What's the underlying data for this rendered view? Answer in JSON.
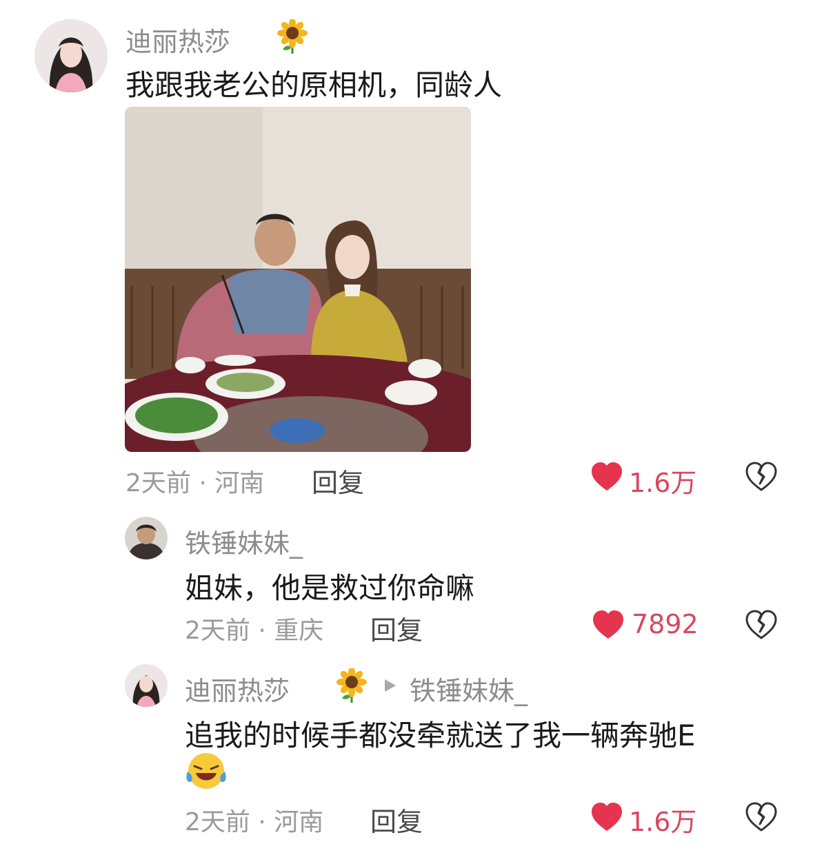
{
  "comments": [
    {
      "username": "迪丽热莎",
      "text": "我跟我老公的原相机，同龄人",
      "time_location": "2天前 · 河南",
      "reply_label": "回复",
      "like_count": "1.6万"
    },
    {
      "username": "铁锤妹妹_",
      "text": "姐妹，他是救过你命嘛",
      "time_location": "2天前 · 重庆",
      "reply_label": "回复",
      "like_count": "7892"
    },
    {
      "username": "迪丽热莎",
      "reply_to": "铁锤妹妹_",
      "text": "追我的时候手都没牵就送了我一辆奔驰E",
      "time_location": "2天前 · 河南",
      "reply_label": "回复",
      "like_count": "1.6万"
    }
  ],
  "colors": {
    "like_heart": "#e5344e",
    "like_count": "#d9475f",
    "meta_text": "#9a9a9a",
    "username": "#8c8c8c"
  },
  "icons": [
    "sunflower-icon",
    "heart-icon",
    "broken-heart-icon",
    "play-arrow-icon",
    "laughing-emoji-icon"
  ]
}
